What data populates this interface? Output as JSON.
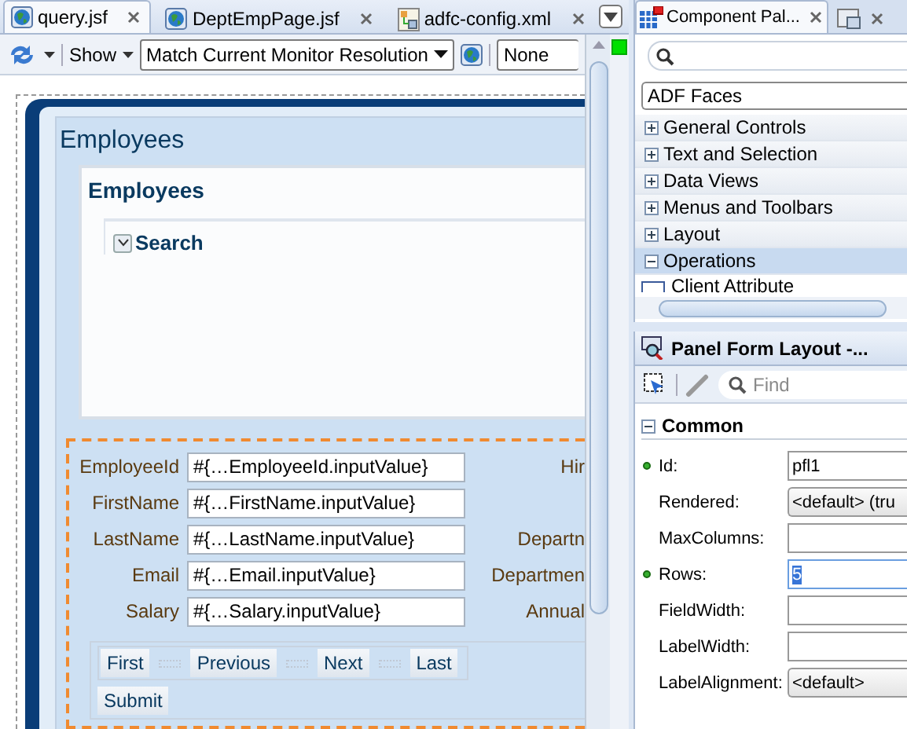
{
  "editor_tabs": [
    {
      "label": "query.jsf",
      "selected": true,
      "kind": "page"
    },
    {
      "label": "DeptEmpPage.jsf",
      "selected": false,
      "kind": "page"
    },
    {
      "label": "adfc-config.xml",
      "selected": false,
      "kind": "diagram"
    }
  ],
  "toolbar": {
    "show_label": "Show",
    "resolution": "Match Current Monitor Resolution",
    "skin": "None"
  },
  "page": {
    "title": "Employees",
    "panel_title": "Employees",
    "search_label": "Search",
    "search_expanded": true,
    "fields": [
      {
        "label": "EmployeeId",
        "value": "#{…EmployeeId.inputValue}",
        "side_label": "Hir"
      },
      {
        "label": "FirstName",
        "value": "#{…FirstName.inputValue}"
      },
      {
        "label": "LastName",
        "value": "#{…LastName.inputValue}",
        "side_label": "Departn"
      },
      {
        "label": "Email",
        "value": "#{…Email.inputValue}",
        "side_label": "Departmen"
      },
      {
        "label": "Salary",
        "value": "#{…Salary.inputValue}",
        "side_label": "Annual"
      }
    ],
    "nav_buttons": [
      "First",
      "Previous",
      "Next",
      "Last"
    ],
    "submit": "Submit"
  },
  "palette": {
    "tabs": [
      {
        "label": "Component Pal...",
        "selected": true
      },
      {
        "selected": false
      }
    ],
    "library": "ADF Faces",
    "categories": [
      {
        "label": "General Controls",
        "expanded": false
      },
      {
        "label": "Text and Selection",
        "expanded": false
      },
      {
        "label": "Data Views",
        "expanded": false
      },
      {
        "label": "Menus and Toolbars",
        "expanded": false
      },
      {
        "label": "Layout",
        "expanded": false
      },
      {
        "label": "Operations",
        "expanded": true
      }
    ],
    "partial_item": "Client Attribute"
  },
  "properties": {
    "tab": "Panel Form Layout -...",
    "search_placeholder": "Find",
    "section": "Common",
    "section_expanded": true,
    "rows": [
      {
        "label": "Id:",
        "kind": "text",
        "value": "pfl1",
        "set": true
      },
      {
        "label": "Rendered:",
        "kind": "select",
        "value": "<default> (tru",
        "set": false
      },
      {
        "label": "MaxColumns:",
        "kind": "text",
        "set": false
      },
      {
        "label": "Rows:",
        "kind": "text",
        "value": "5",
        "set": true,
        "focused": true
      },
      {
        "label": "FieldWidth:",
        "kind": "text",
        "set": false
      },
      {
        "label": "LabelWidth:",
        "kind": "text",
        "set": false
      },
      {
        "label": "LabelAlignment:",
        "kind": "select",
        "value": "<default>",
        "set": false
      }
    ]
  }
}
